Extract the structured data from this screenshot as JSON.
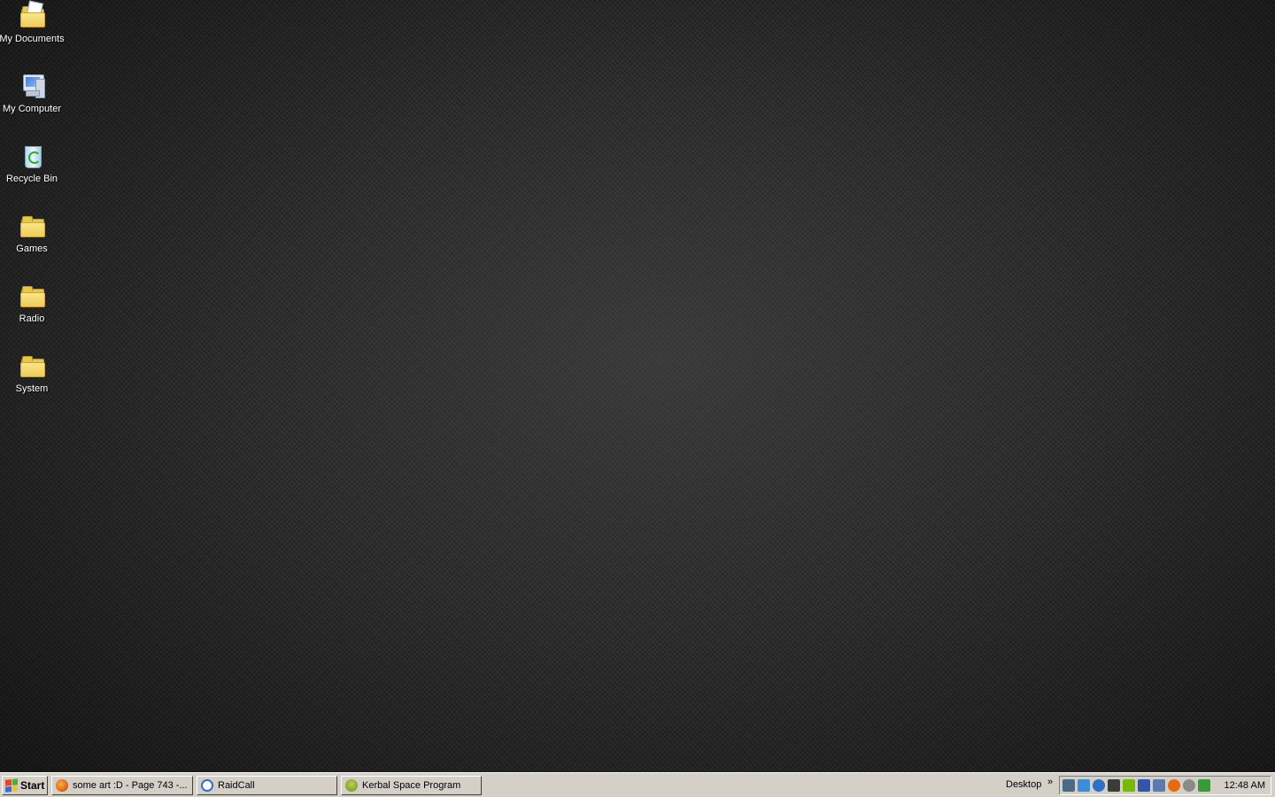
{
  "desktop": {
    "icons": [
      {
        "label": "My Documents",
        "icon": "my-documents-icon"
      },
      {
        "label": "My Computer",
        "icon": "my-computer-icon"
      },
      {
        "label": "Recycle Bin",
        "icon": "recycle-bin-icon"
      },
      {
        "label": "Games",
        "icon": "folder-icon"
      },
      {
        "label": "Radio",
        "icon": "folder-icon"
      },
      {
        "label": "System",
        "icon": "folder-icon"
      }
    ]
  },
  "taskbar": {
    "start_label": "Start",
    "tasks": [
      {
        "label": "some art :D - Page 743 -...",
        "icon": "firefox-icon",
        "color": "#e26a1b"
      },
      {
        "label": "RaidCall",
        "icon": "raidcall-icon",
        "color": "#2f6fc4"
      },
      {
        "label": "Kerbal Space Program",
        "icon": "kerbal-icon",
        "color": "#6d8f2a"
      }
    ],
    "toolbar_label": "Desktop",
    "chevron": "»",
    "tray_icons": [
      {
        "icon": "network-icon",
        "color": "#4a6a8a"
      },
      {
        "icon": "dropbox-icon",
        "color": "#3a8fd8"
      },
      {
        "icon": "raidcall-tray-icon",
        "color": "#2f6fc4"
      },
      {
        "icon": "steam-icon",
        "color": "#3b3b3b"
      },
      {
        "icon": "nvidia-icon",
        "color": "#76b900"
      },
      {
        "icon": "language-icon",
        "color": "#3355aa"
      },
      {
        "icon": "safely-remove-icon",
        "color": "#5a7ab0"
      },
      {
        "icon": "avast-icon",
        "color": "#e86a10"
      },
      {
        "icon": "shield-icon",
        "color": "#8a8a8a"
      },
      {
        "icon": "volume-icon",
        "color": "#3a9a3a"
      }
    ],
    "clock": "12:48 AM"
  }
}
